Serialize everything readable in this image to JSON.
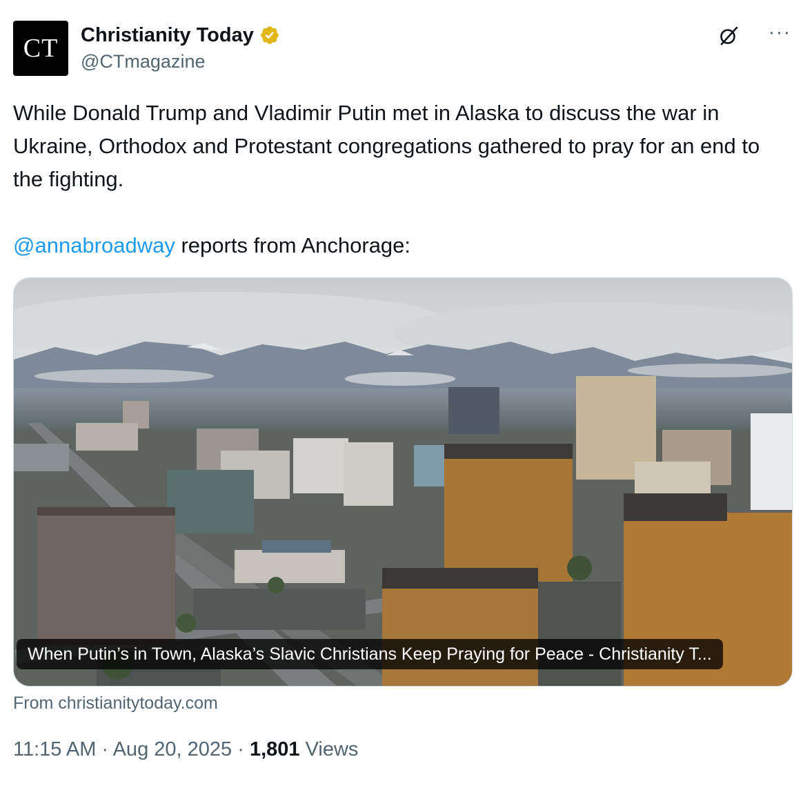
{
  "account": {
    "avatar_text": "CT",
    "display_name": "Christianity Today",
    "handle": "@CTmagazine",
    "verified_badge_color": "#e2b719"
  },
  "icons": {
    "grok": "grok-icon",
    "more": "more-horizontal-icon",
    "verified": "verified-badge-icon"
  },
  "tweet": {
    "text": "While Donald Trump and Vladimir Putin met in Alaska to discuss the war in Ukraine, Orthodox and Protestant congregations gathered to pray for an end to the fighting.",
    "mention": "@annabroadway",
    "mention_suffix": " reports from Anchorage:"
  },
  "card": {
    "title": "When Putin’s in Town, Alaska’s Slavic Christians Keep Praying for Peace - Christianity T...",
    "source": "From christianitytoday.com"
  },
  "meta": {
    "time": "11:15 AM",
    "separator": "·",
    "date": "Aug 20, 2025",
    "views_count": "1,801",
    "views_label": "Views"
  },
  "colors": {
    "link": "#1d9bf0",
    "secondary_text": "#536471",
    "primary_text": "#0f1419"
  }
}
